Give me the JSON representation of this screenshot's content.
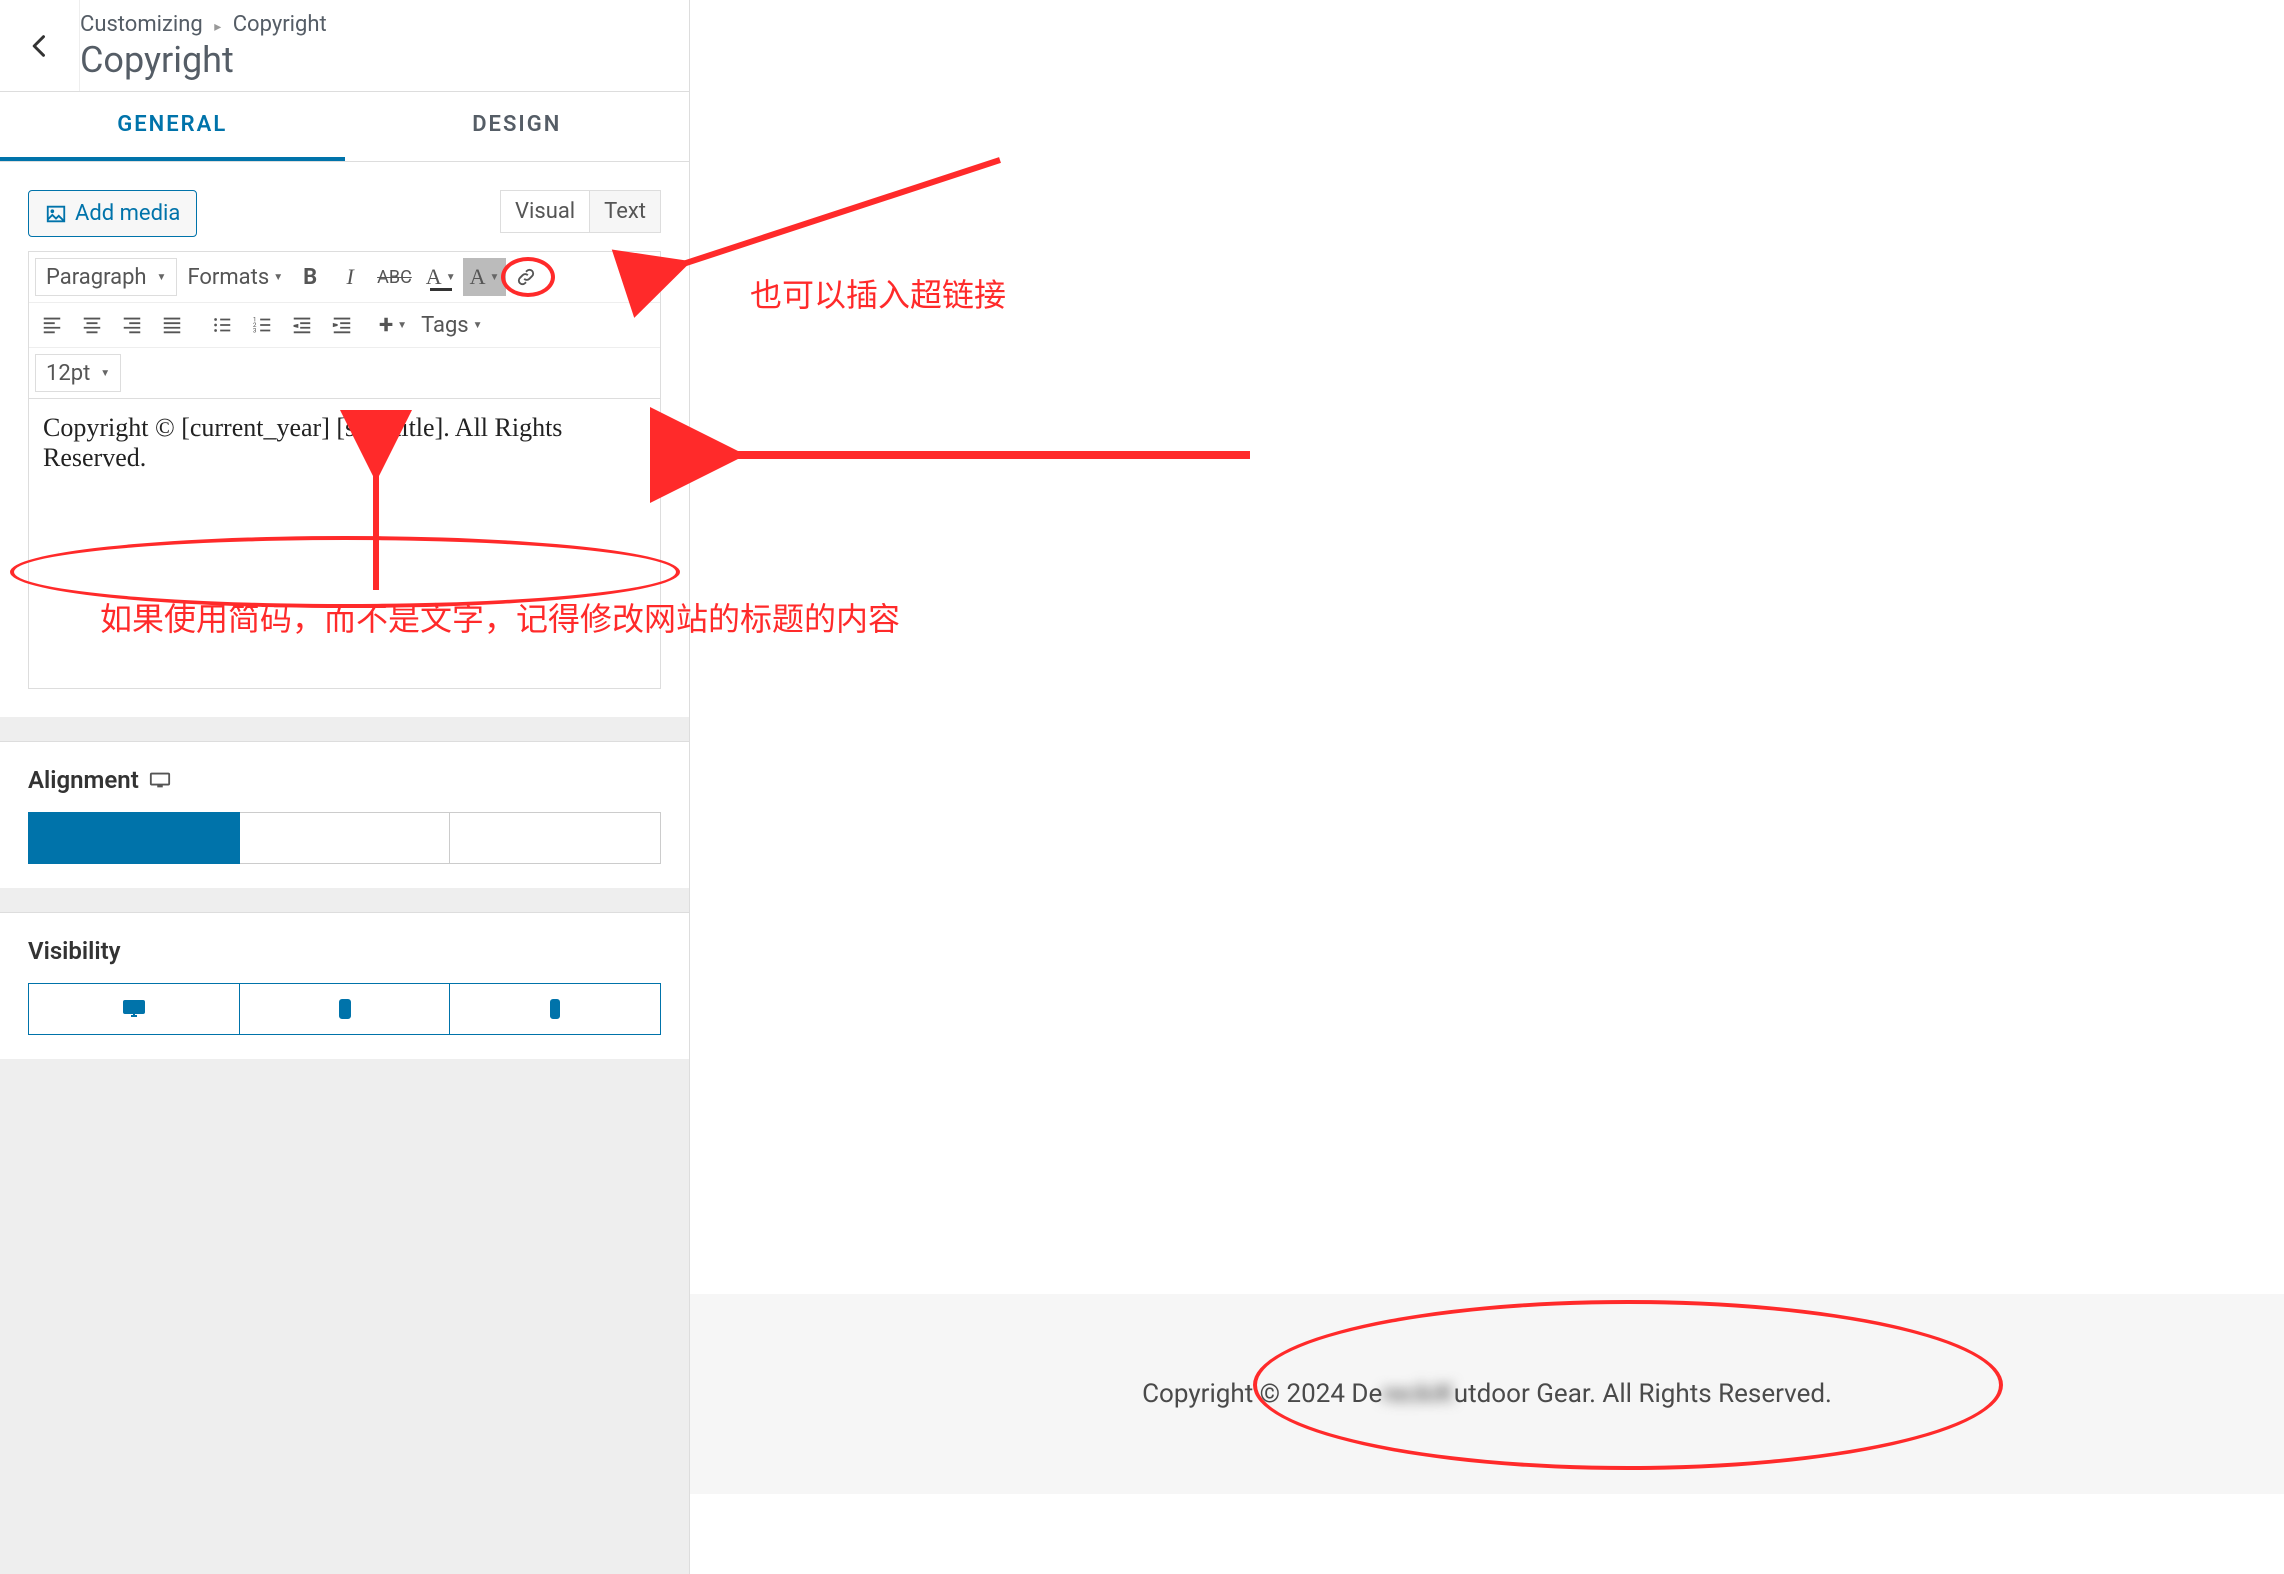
{
  "header": {
    "breadcrumb_customizing": "Customizing",
    "breadcrumb_section": "Copyright",
    "title": "Copyright"
  },
  "tabs": {
    "general": "General",
    "design": "Design"
  },
  "editor_toolbar": {
    "add_media": "Add media",
    "mode_visual": "Visual",
    "mode_text": "Text",
    "paragraph": "Paragraph",
    "formats": "Formats",
    "tags": "Tags",
    "font_size": "12pt"
  },
  "editor_content": "Copyright © [current_year] [site_title]. All Rights Reserved.",
  "controls": {
    "alignment_label": "Alignment",
    "visibility_label": "Visibility"
  },
  "annotations": {
    "link_note": "也可以插入超链接",
    "shortcode_note": "如果使用简码，而不是文字，记得修改网站的标题的内容"
  },
  "preview_footer": {
    "prefix": "Copyright © 2024 De",
    "blurred": "reckiK",
    "suffix": "utdoor Gear. All Rights Reserved."
  }
}
